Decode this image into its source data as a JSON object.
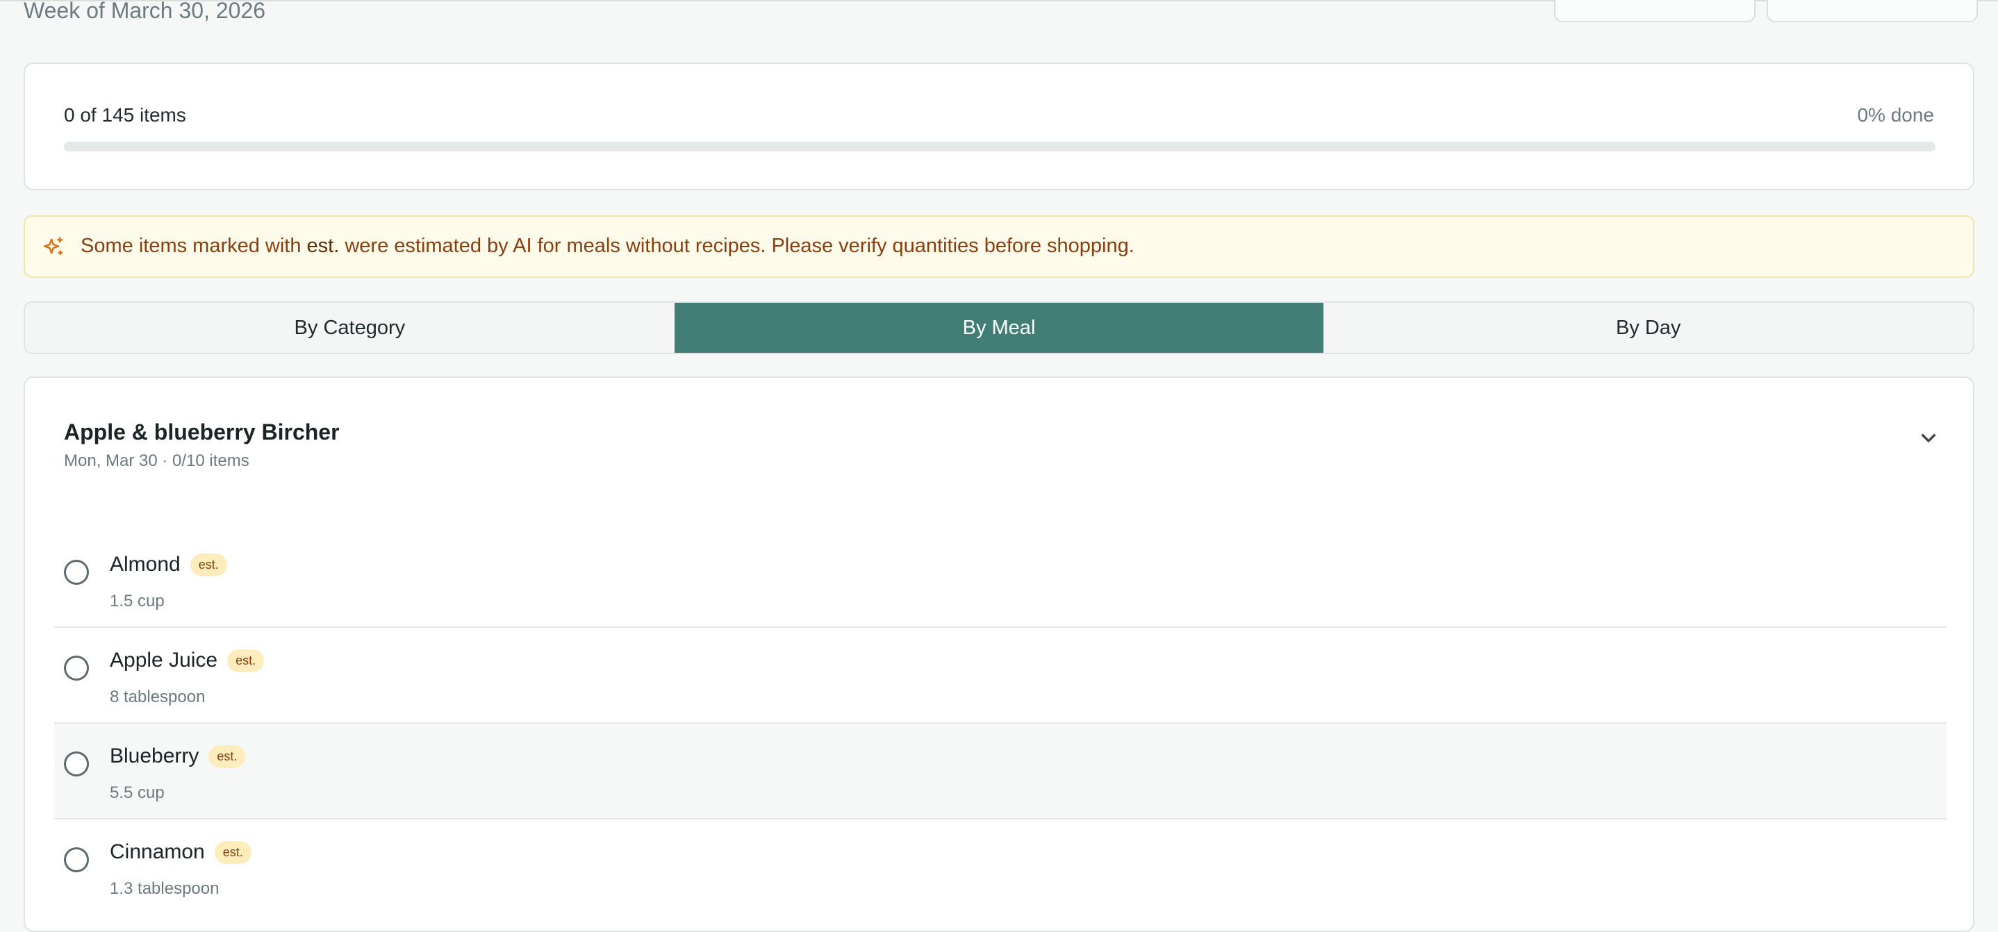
{
  "header": {
    "week_label": "Week of March 30, 2026"
  },
  "progress": {
    "count_label": "0 of 145 items",
    "done_label": "0% done",
    "fraction_done": 0,
    "fill_color": "#417e76"
  },
  "ai_notice": {
    "icon": "sparkle-icon",
    "text_before": "Some items marked with ",
    "text_emphasis": "est.",
    "text_after": " were estimated by AI for meals without recipes. Please verify quantities before shopping."
  },
  "view_tabs": [
    {
      "label": "By Category",
      "active": false
    },
    {
      "label": "By Meal",
      "active": true
    },
    {
      "label": "By Day",
      "active": false
    }
  ],
  "meal": {
    "title": "Apple & blueberry Bircher",
    "subtitle": "Mon, Mar 30 · 0/10 items",
    "toggle_icon": "chevron-down-icon",
    "items": [
      {
        "name": "Almond",
        "badge": "est.",
        "quantity": "1.5 cup",
        "checked": false
      },
      {
        "name": "Apple Juice",
        "badge": "est.",
        "quantity": "8 tablespoon",
        "checked": false
      },
      {
        "name": "Blueberry",
        "badge": "est.",
        "quantity": "5.5 cup",
        "checked": false
      },
      {
        "name": "Cinnamon",
        "badge": "est.",
        "quantity": "1.3 tablespoon",
        "checked": false
      }
    ]
  },
  "colors": {
    "accent": "#417e76",
    "banner_bg": "#fffbeb",
    "banner_text": "#8a3d0e",
    "badge_bg": "#fdedbd"
  }
}
